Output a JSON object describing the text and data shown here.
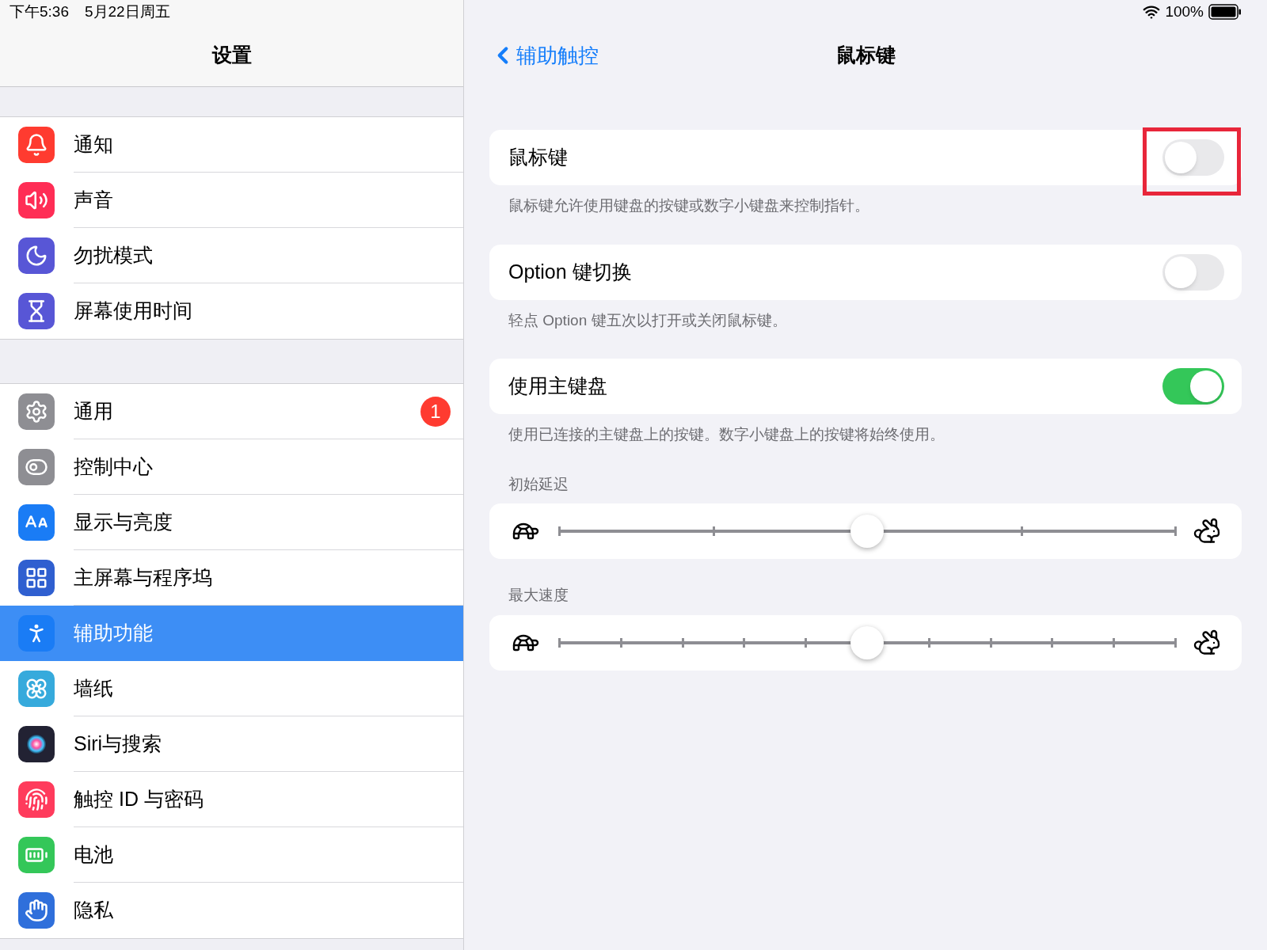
{
  "status_bar": {
    "time": "下午5:36",
    "date": "5月22日周五",
    "battery": "100%"
  },
  "sidebar": {
    "title": "设置",
    "groups": [
      [
        {
          "label": "通知",
          "color": "#ff3b30",
          "selected": false
        },
        {
          "label": "声音",
          "color": "#ff2d55",
          "selected": false
        },
        {
          "label": "勿扰模式",
          "color": "#5856d6",
          "selected": false
        },
        {
          "label": "屏幕使用时间",
          "color": "#5856d6",
          "selected": false
        }
      ],
      [
        {
          "label": "通用",
          "color": "#8e8e93",
          "selected": false,
          "badge": "1"
        },
        {
          "label": "控制中心",
          "color": "#8e8e93",
          "selected": false
        },
        {
          "label": "显示与亮度",
          "color": "#1a7cf5",
          "selected": false
        },
        {
          "label": "主屏幕与程序坞",
          "color": "#2f5fd0",
          "selected": false
        },
        {
          "label": "辅助功能",
          "color": "#1a7cf5",
          "selected": true
        },
        {
          "label": "墙纸",
          "color": "#36aadc",
          "selected": false
        },
        {
          "label": "Siri与搜索",
          "color": "#222233",
          "selected": false
        },
        {
          "label": "触控 ID 与密码",
          "color": "#ff3b5c",
          "selected": false
        },
        {
          "label": "电池",
          "color": "#34c759",
          "selected": false
        },
        {
          "label": "隐私",
          "color": "#2f6fdb",
          "selected": false
        }
      ]
    ]
  },
  "detail": {
    "back": "辅助触控",
    "title": "鼠标键",
    "sections": [
      {
        "kind": "toggle",
        "label": "鼠标键",
        "on": false,
        "highlighted": true,
        "footer": "鼠标键允许使用键盘的按键或数字小键盘来控制指针。"
      },
      {
        "kind": "toggle",
        "label": "Option 键切换",
        "on": false,
        "highlighted": false,
        "footer": "轻点 Option 键五次以打开或关闭鼠标键。"
      },
      {
        "kind": "toggle",
        "label": "使用主键盘",
        "on": true,
        "highlighted": false,
        "footer": "使用已连接的主键盘上的按键。数字小键盘上的按键将始终使用。"
      },
      {
        "kind": "slider",
        "header": "初始延迟",
        "level": 0.5,
        "fine_steps": false
      },
      {
        "kind": "slider",
        "header": "最大速度",
        "level": 0.5,
        "fine_steps": true
      }
    ]
  }
}
